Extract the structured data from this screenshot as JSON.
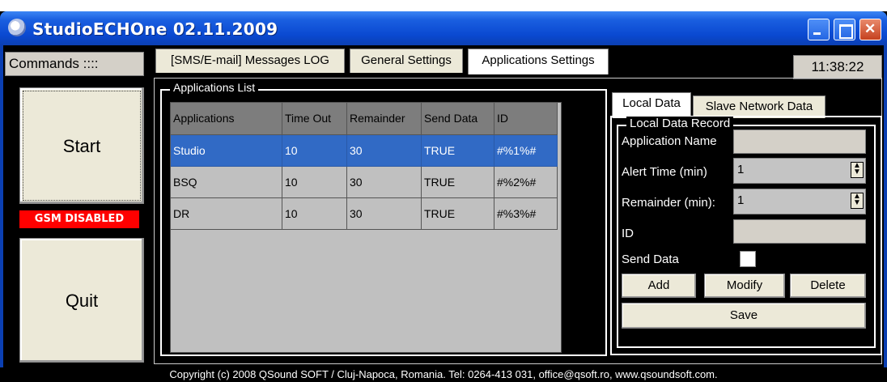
{
  "window": {
    "title": "StudioECHOne 02.11.2009",
    "app_icon": "app-icon"
  },
  "left": {
    "commands_label": "Commands ::::",
    "start_label": "Start",
    "gsm_status": "GSM DISABLED",
    "quit_label": "Quit"
  },
  "tabs": [
    {
      "label": "[SMS/E-mail] Messages LOG",
      "active": false
    },
    {
      "label": "General Settings",
      "active": false
    },
    {
      "label": "Applications Settings",
      "active": true
    }
  ],
  "clock": "11:38:22",
  "apps": {
    "group_title": "Applications List",
    "columns": [
      "Applications",
      "Time Out",
      "Remainder",
      "Send Data",
      "ID"
    ],
    "rows": [
      [
        "Studio",
        "10",
        "30",
        "TRUE",
        "#%1%#"
      ],
      [
        "BSQ",
        "10",
        "30",
        "TRUE",
        "#%2%#"
      ],
      [
        "DR",
        "10",
        "30",
        "TRUE",
        "#%3%#"
      ]
    ],
    "selected_row": 0
  },
  "right": {
    "tabs": [
      {
        "label": "Local Data",
        "active": true
      },
      {
        "label": "Slave Network Data",
        "active": false
      }
    ],
    "group_title": "Local Data Record",
    "application_name_label": "Application Name",
    "application_name_value": "",
    "alert_time_label": "Alert Time (min)",
    "alert_time_value": "1",
    "remainder_label": "Remainder (min):",
    "remainder_value": "1",
    "id_label": "ID",
    "id_value": "",
    "send_data_label": "Send Data",
    "send_data_checked": false,
    "add_label": "Add",
    "modify_label": "Modify",
    "delete_label": "Delete",
    "save_label": "Save"
  },
  "status": {
    "copyright": "Copyright (c) 2008  QSound SOFT / Cluj-Napoca, Romania. Tel: 0264-413 031, office@qsoft.ro, www.qsoundsoft.com."
  },
  "colors": {
    "titlebar": "#0a49d1",
    "selection": "#316ac5",
    "gsm_badge": "#ff0000"
  }
}
